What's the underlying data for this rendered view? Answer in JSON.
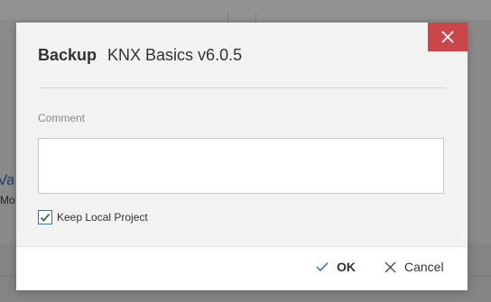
{
  "background": {
    "left_title_fragment": "Va",
    "left_subtitle_fragment": "Mo"
  },
  "dialog": {
    "title_label": "Backup",
    "title_value": "KNX Basics v6.0.5",
    "comment_label": "Comment",
    "comment_value": "",
    "keep_local_project": {
      "label": "Keep Local Project",
      "checked": true
    },
    "close_icon": "close-icon",
    "buttons": {
      "ok_label": "OK",
      "cancel_label": "Cancel"
    },
    "colors": {
      "close_button_bg": "#c9474b",
      "checkbox_accent": "#3a6ea5",
      "dialog_bg": "#f2f2f2",
      "footer_bg": "#ffffff"
    }
  }
}
